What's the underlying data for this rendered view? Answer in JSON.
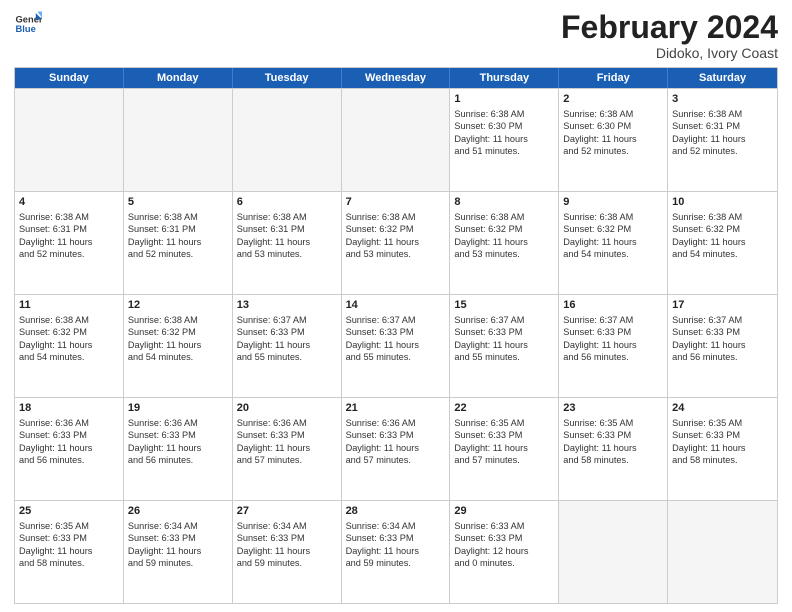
{
  "logo": {
    "line1": "General",
    "line2": "Blue"
  },
  "title": "February 2024",
  "subtitle": "Didoko, Ivory Coast",
  "days": [
    "Sunday",
    "Monday",
    "Tuesday",
    "Wednesday",
    "Thursday",
    "Friday",
    "Saturday"
  ],
  "weeks": [
    [
      {
        "day": "",
        "info": ""
      },
      {
        "day": "",
        "info": ""
      },
      {
        "day": "",
        "info": ""
      },
      {
        "day": "",
        "info": ""
      },
      {
        "day": "1",
        "info": "Sunrise: 6:38 AM\nSunset: 6:30 PM\nDaylight: 11 hours\nand 51 minutes."
      },
      {
        "day": "2",
        "info": "Sunrise: 6:38 AM\nSunset: 6:30 PM\nDaylight: 11 hours\nand 52 minutes."
      },
      {
        "day": "3",
        "info": "Sunrise: 6:38 AM\nSunset: 6:31 PM\nDaylight: 11 hours\nand 52 minutes."
      }
    ],
    [
      {
        "day": "4",
        "info": "Sunrise: 6:38 AM\nSunset: 6:31 PM\nDaylight: 11 hours\nand 52 minutes."
      },
      {
        "day": "5",
        "info": "Sunrise: 6:38 AM\nSunset: 6:31 PM\nDaylight: 11 hours\nand 52 minutes."
      },
      {
        "day": "6",
        "info": "Sunrise: 6:38 AM\nSunset: 6:31 PM\nDaylight: 11 hours\nand 53 minutes."
      },
      {
        "day": "7",
        "info": "Sunrise: 6:38 AM\nSunset: 6:32 PM\nDaylight: 11 hours\nand 53 minutes."
      },
      {
        "day": "8",
        "info": "Sunrise: 6:38 AM\nSunset: 6:32 PM\nDaylight: 11 hours\nand 53 minutes."
      },
      {
        "day": "9",
        "info": "Sunrise: 6:38 AM\nSunset: 6:32 PM\nDaylight: 11 hours\nand 54 minutes."
      },
      {
        "day": "10",
        "info": "Sunrise: 6:38 AM\nSunset: 6:32 PM\nDaylight: 11 hours\nand 54 minutes."
      }
    ],
    [
      {
        "day": "11",
        "info": "Sunrise: 6:38 AM\nSunset: 6:32 PM\nDaylight: 11 hours\nand 54 minutes."
      },
      {
        "day": "12",
        "info": "Sunrise: 6:38 AM\nSunset: 6:32 PM\nDaylight: 11 hours\nand 54 minutes."
      },
      {
        "day": "13",
        "info": "Sunrise: 6:37 AM\nSunset: 6:33 PM\nDaylight: 11 hours\nand 55 minutes."
      },
      {
        "day": "14",
        "info": "Sunrise: 6:37 AM\nSunset: 6:33 PM\nDaylight: 11 hours\nand 55 minutes."
      },
      {
        "day": "15",
        "info": "Sunrise: 6:37 AM\nSunset: 6:33 PM\nDaylight: 11 hours\nand 55 minutes."
      },
      {
        "day": "16",
        "info": "Sunrise: 6:37 AM\nSunset: 6:33 PM\nDaylight: 11 hours\nand 56 minutes."
      },
      {
        "day": "17",
        "info": "Sunrise: 6:37 AM\nSunset: 6:33 PM\nDaylight: 11 hours\nand 56 minutes."
      }
    ],
    [
      {
        "day": "18",
        "info": "Sunrise: 6:36 AM\nSunset: 6:33 PM\nDaylight: 11 hours\nand 56 minutes."
      },
      {
        "day": "19",
        "info": "Sunrise: 6:36 AM\nSunset: 6:33 PM\nDaylight: 11 hours\nand 56 minutes."
      },
      {
        "day": "20",
        "info": "Sunrise: 6:36 AM\nSunset: 6:33 PM\nDaylight: 11 hours\nand 57 minutes."
      },
      {
        "day": "21",
        "info": "Sunrise: 6:36 AM\nSunset: 6:33 PM\nDaylight: 11 hours\nand 57 minutes."
      },
      {
        "day": "22",
        "info": "Sunrise: 6:35 AM\nSunset: 6:33 PM\nDaylight: 11 hours\nand 57 minutes."
      },
      {
        "day": "23",
        "info": "Sunrise: 6:35 AM\nSunset: 6:33 PM\nDaylight: 11 hours\nand 58 minutes."
      },
      {
        "day": "24",
        "info": "Sunrise: 6:35 AM\nSunset: 6:33 PM\nDaylight: 11 hours\nand 58 minutes."
      }
    ],
    [
      {
        "day": "25",
        "info": "Sunrise: 6:35 AM\nSunset: 6:33 PM\nDaylight: 11 hours\nand 58 minutes."
      },
      {
        "day": "26",
        "info": "Sunrise: 6:34 AM\nSunset: 6:33 PM\nDaylight: 11 hours\nand 59 minutes."
      },
      {
        "day": "27",
        "info": "Sunrise: 6:34 AM\nSunset: 6:33 PM\nDaylight: 11 hours\nand 59 minutes."
      },
      {
        "day": "28",
        "info": "Sunrise: 6:34 AM\nSunset: 6:33 PM\nDaylight: 11 hours\nand 59 minutes."
      },
      {
        "day": "29",
        "info": "Sunrise: 6:33 AM\nSunset: 6:33 PM\nDaylight: 12 hours\nand 0 minutes."
      },
      {
        "day": "",
        "info": ""
      },
      {
        "day": "",
        "info": ""
      }
    ]
  ]
}
